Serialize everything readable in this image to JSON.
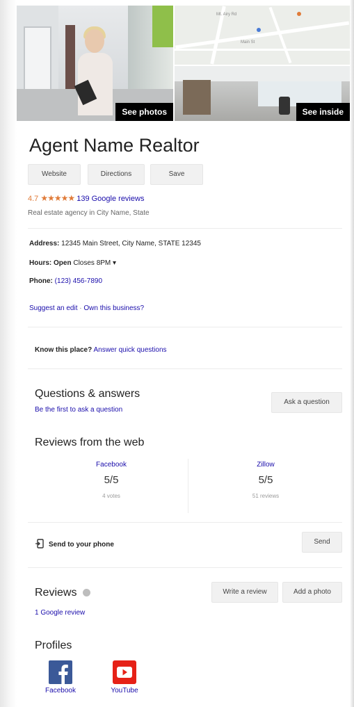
{
  "photos": {
    "left_label": "See photos",
    "right_label": "See inside"
  },
  "business": {
    "name": "Agent Name Realtor",
    "category": "Real estate agency in City Name, State"
  },
  "actions": {
    "website": "Website",
    "directions": "Directions",
    "save": "Save"
  },
  "rating": {
    "value": "4.7",
    "stars": "★★★★★",
    "reviews_link": "139 Google reviews"
  },
  "details": {
    "address_label": "Address:",
    "address_value": "12345 Main Street, City Name, STATE 12345",
    "hours_label": "Hours:",
    "hours_status": "Open",
    "hours_value": "Closes 8PM",
    "hours_caret": "▾",
    "phone_label": "Phone:",
    "phone_value": "(123) 456-7890",
    "suggest_edit": "Suggest an edit",
    "separator": "·",
    "own_business": "Own this business?"
  },
  "know_place": {
    "prompt": "Know this place?",
    "link": "Answer quick questions"
  },
  "qa": {
    "heading": "Questions & answers",
    "subtext": "Be the first to ask a question",
    "ask_button": "Ask a question"
  },
  "web_reviews": {
    "heading": "Reviews from the web",
    "items": [
      {
        "source": "Facebook",
        "score": "5/5",
        "count": "4 votes"
      },
      {
        "source": "Zillow",
        "score": "5/5",
        "count": "51 reviews"
      }
    ]
  },
  "send": {
    "label": "Send to your phone",
    "button": "Send"
  },
  "reviews": {
    "heading": "Reviews",
    "count_link": "1 Google review",
    "write_button": "Write a review",
    "photo_button": "Add a photo"
  },
  "profiles": {
    "heading": "Profiles",
    "items": [
      {
        "name": "Facebook",
        "icon": "facebook-icon",
        "color": "#3b5998"
      },
      {
        "name": "YouTube",
        "icon": "youtube-icon",
        "color": "#e62117"
      }
    ]
  },
  "colors": {
    "link": "#1a0dab",
    "star": "#e07b39",
    "button_bg": "#f1f1f1"
  }
}
